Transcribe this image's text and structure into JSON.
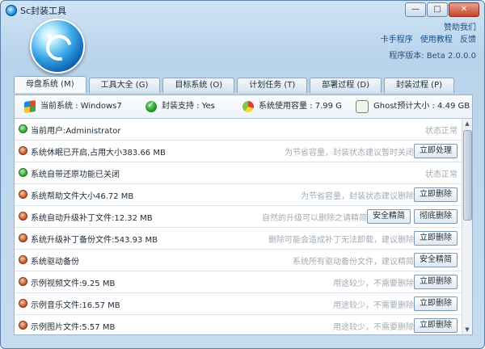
{
  "window": {
    "title": "Sc封装工具",
    "controls": {
      "minimize": "—",
      "maximize": "□",
      "close": "✕"
    }
  },
  "header": {
    "links": [
      "赞助我们",
      "卡手程序",
      "使用教程",
      "反馈"
    ],
    "version": "程序版本: Beta 2.0.0.0"
  },
  "tabs": [
    {
      "label": "母盘系统 (M)",
      "active": true
    },
    {
      "label": "工具大全 (G)",
      "active": false
    },
    {
      "label": "目标系统 (O)",
      "active": false
    },
    {
      "label": "计划任务 (T)",
      "active": false
    },
    {
      "label": "部署过程 (D)",
      "active": false
    },
    {
      "label": "封装过程 (P)",
      "active": false
    }
  ],
  "info": {
    "os": "当前系统 : Windows7",
    "support": "封装支持 : Yes",
    "used": "系统使用容量 : 7.99 G",
    "ghost": "Ghost预计大小 : 4.49 GB"
  },
  "rows": [
    {
      "status": "ok",
      "label": "当前用户:Administrator",
      "desc": "状态正常",
      "buttons": []
    },
    {
      "status": "warn",
      "label": "系统休眠已开启,占用大小383.66 MB",
      "desc": "为节省容量，封装状态建议暂时关闭",
      "buttons": [
        "立即处理"
      ]
    },
    {
      "status": "ok",
      "label": "系统自带还原功能已关闭",
      "desc": "状态正常",
      "buttons": []
    },
    {
      "status": "warn",
      "label": "系统帮助文件大小46.72 MB",
      "desc": "为节省容量，封装状态建议删除",
      "buttons": [
        "立即删除"
      ]
    },
    {
      "status": "warn",
      "label": "系统自动升级补丁文件:12.32 MB",
      "desc": "自然的升级可以删除之请精简",
      "buttons": [
        "安全精简",
        "彻底删除"
      ]
    },
    {
      "status": "warn",
      "label": "系统升级补丁备份文件:543.93 MB",
      "desc": "删除可能会造成补丁无法卸载，建议删除",
      "buttons": [
        "立即删除"
      ]
    },
    {
      "status": "warn",
      "label": "系统驱动备份",
      "desc": "系统所有驱动备份文件，建议精简",
      "buttons": [
        "安全精简"
      ]
    },
    {
      "status": "warn",
      "label": "示例视频文件:9.25 MB",
      "desc": "用途较少，不需要删除",
      "buttons": [
        "立即删除"
      ]
    },
    {
      "status": "warn",
      "label": "示例音乐文件:16.57 MB",
      "desc": "用途较少，不需要删除",
      "buttons": [
        "立即删除"
      ]
    },
    {
      "status": "warn",
      "label": "示例图片文件:5.57 MB",
      "desc": "用途较少，不需要删除",
      "buttons": [
        "立即删除"
      ]
    }
  ]
}
